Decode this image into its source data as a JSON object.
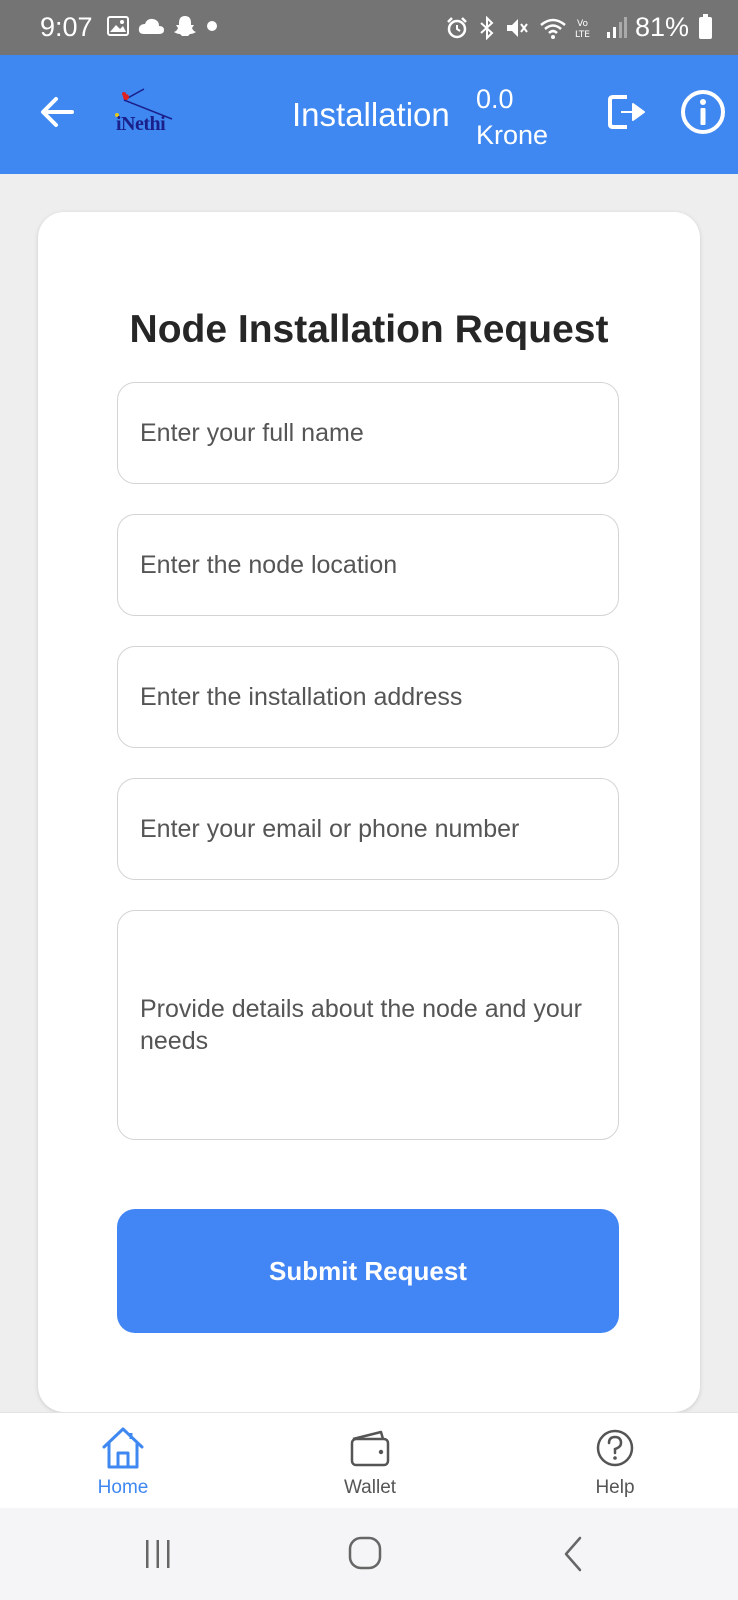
{
  "status_bar": {
    "time": "9:07",
    "battery": "81%",
    "icons": [
      "gallery-icon",
      "cloud-icon",
      "snapchat-icon",
      "dot-icon",
      "alarm-icon",
      "bluetooth-icon",
      "mute-icon",
      "wifi-icon",
      "volte-icon",
      "signal-icon",
      "battery-icon"
    ]
  },
  "app_bar": {
    "title": "Installation",
    "balance_amount": "0.0",
    "balance_currency": "Krone",
    "logo_text": "iNethi",
    "color": "#3f88f2"
  },
  "form": {
    "title": "Node Installation Request",
    "full_name_placeholder": "Enter your full name",
    "node_location_placeholder": "Enter the node location",
    "address_placeholder": "Enter the installation address",
    "contact_placeholder": "Enter your email or phone number",
    "details_placeholder": "Provide details about the node and your needs",
    "submit_label": "Submit Request",
    "accent_color": "#4285f4"
  },
  "bottom_nav": {
    "items": [
      {
        "label": "Home",
        "icon": "home-icon",
        "active": true,
        "color": "#3f88f2"
      },
      {
        "label": "Wallet",
        "icon": "wallet-icon",
        "active": false,
        "color": "#555555"
      },
      {
        "label": "Help",
        "icon": "help-icon",
        "active": false,
        "color": "#555555"
      }
    ]
  },
  "system_nav": {
    "icons": [
      "recent-apps-icon",
      "home-button-icon",
      "back-icon"
    ]
  }
}
